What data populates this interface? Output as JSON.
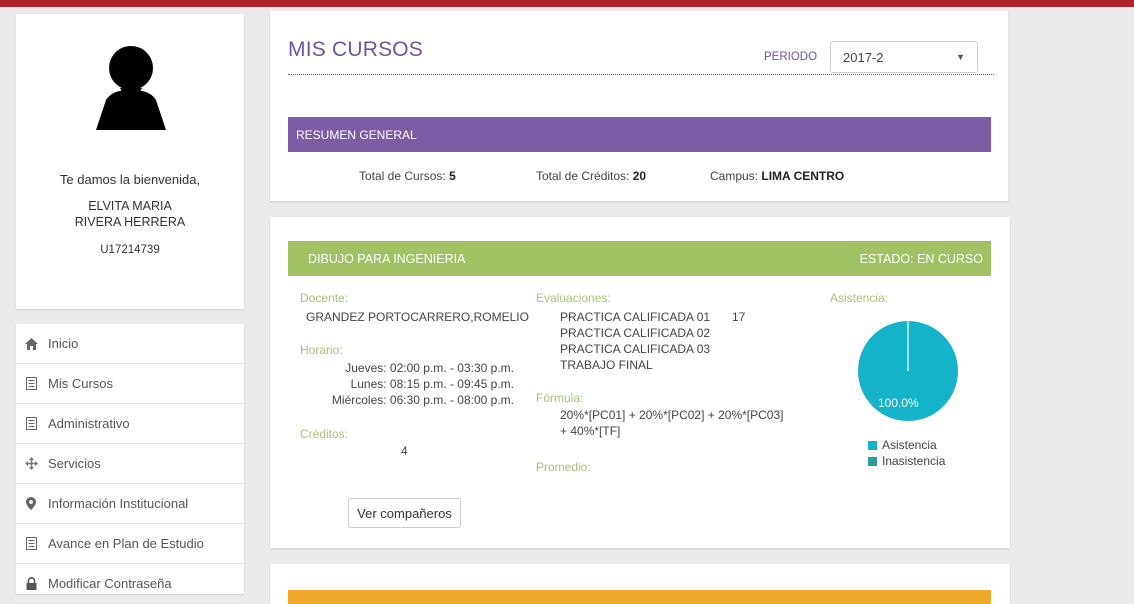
{
  "colors": {
    "topbar": "#b0202d",
    "purple": "#7b5ca5",
    "green": "#a2c163",
    "teal": "#14b3c9",
    "dark_teal": "#2a9c9c",
    "orange": "#f0a82c"
  },
  "profile": {
    "welcome": "Te damos la bienvenida,",
    "name_line1": "ELVITA MARIA",
    "name_line2": "RIVERA HERRERA",
    "code": "U17214739"
  },
  "menu": {
    "items": [
      {
        "label": "Inicio",
        "icon": "home-icon"
      },
      {
        "label": "Mis Cursos",
        "icon": "list-icon"
      },
      {
        "label": "Administrativo",
        "icon": "list-icon"
      },
      {
        "label": "Servicios",
        "icon": "arrows-icon"
      },
      {
        "label": "Información Institucional",
        "icon": "map-marker-icon"
      },
      {
        "label": "Avance en Plan de Estudio",
        "icon": "list-icon"
      },
      {
        "label": "Modificar Contraseña",
        "icon": "lock-icon"
      }
    ]
  },
  "header": {
    "title": "MIS CURSOS",
    "periodo_label": "PERIODO",
    "periodo_value": "2017-2"
  },
  "summary": {
    "band": "RESUMEN GENERAL",
    "total_cursos_label": "Total de Cursos:",
    "total_cursos_value": "5",
    "total_creditos_label": "Total de Créditos:",
    "total_creditos_value": "20",
    "campus_label": "Campus:",
    "campus_value": "LIMA CENTRO"
  },
  "course": {
    "name": "DIBUJO PARA INGENIERIA",
    "estado": "ESTADO: EN CURSO",
    "docente_label": "Docente:",
    "docente": "GRANDEZ PORTOCARRERO,ROMELIO",
    "horario_label": "Horario:",
    "horario": [
      "Jueves: 02:00 p.m. - 03:30 p.m.",
      "Lunes: 08:15 p.m. - 09:45 p.m.",
      "Miércoles: 06:30 p.m. - 08:00 p.m."
    ],
    "creditos_label": "Créditos:",
    "creditos": "4",
    "evaluaciones_label": "Evaluaciones:",
    "evaluaciones": [
      {
        "name": "PRACTICA CALIFICADA 01",
        "score": "17"
      },
      {
        "name": "PRACTICA CALIFICADA 02",
        "score": ""
      },
      {
        "name": "PRACTICA CALIFICADA 03",
        "score": ""
      },
      {
        "name": "TRABAJO FINAL",
        "score": ""
      }
    ],
    "formula_label": "Fórmula:",
    "formula_line1": "20%*[PC01] + 20%*[PC02] + 20%*[PC03]",
    "formula_line2": "+ 40%*[TF]",
    "promedio_label": "Promedio:",
    "button": "Ver compañeros",
    "asistencia_label": "Asistencia:",
    "pie_label": "100.0%",
    "legend": [
      "Asistencia",
      "Inasistencia"
    ]
  },
  "chart_data": {
    "type": "pie",
    "title": "Asistencia:",
    "series": [
      {
        "name": "Asistencia",
        "values": [
          100.0
        ]
      },
      {
        "name": "Inasistencia",
        "values": [
          0.0
        ]
      }
    ],
    "categories": [
      "Asistencia",
      "Inasistencia"
    ],
    "values": [
      100.0,
      0.0
    ],
    "legend": "bottom"
  }
}
